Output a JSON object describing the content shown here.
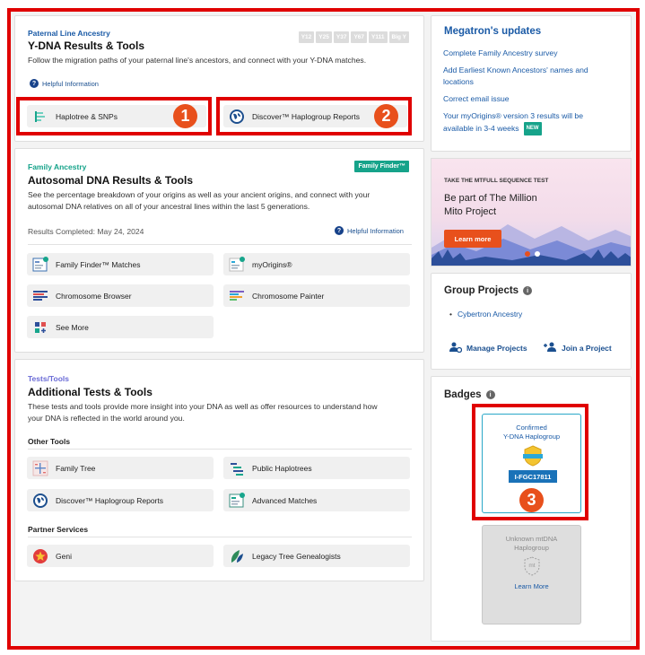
{
  "ydna": {
    "label": "Paternal Line Ancestry",
    "title": "Y-DNA Results & Tools",
    "description": "Follow the migration paths of your paternal line's ancestors, and connect with your Y-DNA matches.",
    "tests": [
      "Y12",
      "Y25",
      "Y37",
      "Y67",
      "Y111",
      "Big Y"
    ],
    "help": "Helpful Information",
    "buttons": [
      "Haplotree & SNPs",
      "Discover™ Haplogroup Reports"
    ]
  },
  "autosomal": {
    "label": "Family Ancestry",
    "badge": "Family Finder™",
    "title": "Autosomal DNA Results & Tools",
    "description_line1": "See the percentage breakdown of your origins as well as your ancient origins, and connect with your",
    "description_line2": "autosomal DNA relatives on all of your ancestral lines within the last 5 generations.",
    "results_completed": "Results Completed: May 24, 2024",
    "help": "Helpful Information",
    "buttons": [
      "Family Finder™ Matches",
      "myOrigins®",
      "Chromosome Browser",
      "Chromosome Painter",
      "See More"
    ]
  },
  "tests_tools": {
    "label": "Tests/Tools",
    "title": "Additional Tests & Tools",
    "description_line1": "These tests and tools provide more insight into your DNA as well as offer resources to understand how",
    "description_line2": "your DNA is reflected in the world around you.",
    "other_tools_heading": "Other Tools",
    "other_tools": [
      "Family Tree",
      "Public Haplotrees",
      "Discover™ Haplogroup Reports",
      "Advanced Matches"
    ],
    "partner_heading": "Partner Services",
    "partners": [
      "Geni",
      "Legacy Tree Genealogists"
    ]
  },
  "updates": {
    "title": "Megatron's updates",
    "items": [
      "Complete Family Ancestry survey",
      "Add Earliest Known Ancestors' names and",
      "locations",
      "Correct email issue",
      "Your myOrigins® version 3 results will be",
      "available in 3-4 weeks"
    ],
    "new_badge": "NEW"
  },
  "promo": {
    "kicker": "TAKE THE MTFULL SEQUENCE TEST",
    "line1": "Be part of The Million",
    "line2": "Mito Project",
    "button": "Learn more"
  },
  "groups": {
    "title": "Group Projects",
    "project": "Cybertron Ancestry",
    "manage": "Manage Projects",
    "join": "Join a Project"
  },
  "badges": {
    "title": "Badges",
    "confirmed_line1": "Confirmed",
    "confirmed_line2": "Y-DNA Haplogroup",
    "haplogroup": "I-FGC17811",
    "unknown_line1": "Unknown mtDNA",
    "unknown_line2": "Haplogroup",
    "mt": "mt",
    "learn_more": "Learn More"
  },
  "callouts": [
    "1",
    "2",
    "3"
  ],
  "colors": {
    "accent_red": "#e00000",
    "callout_orange": "#e8501c",
    "link_blue": "#1a5aa6",
    "teal": "#16a38a"
  }
}
